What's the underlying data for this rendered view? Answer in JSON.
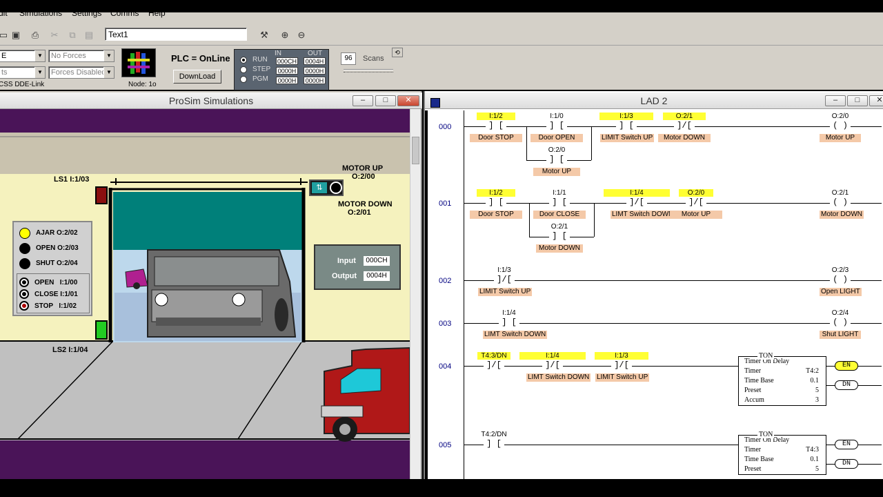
{
  "menu": [
    "dit",
    "Simulations",
    "Settings",
    "Comms",
    "Help"
  ],
  "toolbar": {
    "textbox_value": "Text1"
  },
  "settings": {
    "combo1": "E",
    "combo2": "ts",
    "forces": "No Forces",
    "forces_state": "Forces Disabled",
    "dde": "CSS DDE-Link",
    "node": "Node: 1o"
  },
  "plc": {
    "status": "PLC = OnLine",
    "download": "DownLoad",
    "modes": [
      "RUN",
      "STEP",
      "PGM"
    ],
    "in_header": "IN",
    "out_header": "OUT",
    "in_values": [
      "000CH",
      "0000H",
      "0000H"
    ],
    "out_values": [
      "0004H",
      "0000H",
      "0000H"
    ],
    "scans_value": "96",
    "scans_label": "Scans"
  },
  "prosim": {
    "title": "ProSim Simulations",
    "ls1": "LS1  I:1/03",
    "ls2": "LS2  I:1/04",
    "motor_up": "MOTOR UP",
    "motor_up_addr": "O:2/00",
    "motor_down": "MOTOR DOWN",
    "motor_down_addr": "O:2/01",
    "status_lights": [
      {
        "label": "AJAR",
        "addr": "O:2/02",
        "color": "#ffff00"
      },
      {
        "label": "OPEN",
        "addr": "O:2/03",
        "color": "#000000"
      },
      {
        "label": "SHUT",
        "addr": "O:2/04",
        "color": "#000000"
      }
    ],
    "buttons": [
      {
        "label": "OPEN",
        "addr": "I:1/00"
      },
      {
        "label": "CLOSE",
        "addr": "I:1/01"
      },
      {
        "label": "STOP",
        "addr": "I:1/02"
      }
    ],
    "io_input_label": "Input",
    "io_input_value": "000CH",
    "io_output_label": "Output",
    "io_output_value": "0004H"
  },
  "lad": {
    "title": "LAD 2",
    "rungs": [
      {
        "num": "000",
        "contacts": [
          {
            "addr": "I:1/2",
            "desc": "Door STOP",
            "sym": "] [",
            "hl": true
          },
          {
            "addr": "I:1/0",
            "desc": "Door OPEN",
            "sym": "] [",
            "hl": false
          },
          {
            "addr": "I:1/3",
            "desc": "LIMIT Switch UP",
            "sym": "] [",
            "hl": true
          },
          {
            "addr": "O:2/1",
            "desc": "Motor DOWN",
            "sym": "]/[",
            "hl": true
          }
        ],
        "branch": {
          "addr": "O:2/0",
          "desc": "Motor UP",
          "sym": "] ["
        },
        "coil": {
          "addr": "O:2/0",
          "desc": "Motor UP",
          "sym": "( )"
        }
      },
      {
        "num": "001",
        "contacts": [
          {
            "addr": "I:1/2",
            "desc": "Door STOP",
            "sym": "] [",
            "hl": true
          },
          {
            "addr": "I:1/1",
            "desc": "Door CLOSE",
            "sym": "] [",
            "hl": false
          },
          {
            "addr": "I:1/4",
            "desc": "LIMT Switch DOWN",
            "sym": "]/[",
            "hl": true
          },
          {
            "addr": "O:2/0",
            "desc": "Motor UP",
            "sym": "]/[",
            "hl": true
          }
        ],
        "branch": {
          "addr": "O:2/1",
          "desc": "Motor DOWN",
          "sym": "] ["
        },
        "coil": {
          "addr": "O:2/1",
          "desc": "Motor DOWN",
          "sym": "( )"
        }
      },
      {
        "num": "002",
        "contacts": [
          {
            "addr": "I:1/3",
            "desc": "LIMIT Switch UP",
            "sym": "]/[",
            "hl": false
          }
        ],
        "coil": {
          "addr": "O:2/3",
          "desc": "Open LIGHT",
          "sym": "( )"
        }
      },
      {
        "num": "003",
        "contacts": [
          {
            "addr": "I:1/4",
            "desc": "LIMT Switch DOWN",
            "sym": "] [",
            "hl": false
          }
        ],
        "coil": {
          "addr": "O:2/4",
          "desc": "Shut LIGHT",
          "sym": "( )"
        }
      },
      {
        "num": "004",
        "contacts": [
          {
            "addr": "T4:3/DN",
            "desc": "",
            "sym": "]/[",
            "hl": true
          },
          {
            "addr": "I:1/4",
            "desc": "LIMT Switch DOWN",
            "sym": "]/[",
            "hl": true
          },
          {
            "addr": "I:1/3",
            "desc": "LIMIT Switch UP",
            "sym": "]/[",
            "hl": true
          }
        ],
        "timer": {
          "header": "TON",
          "name": "Timer On Delay",
          "timer_label": "Timer",
          "timer": "T4:2",
          "base_label": "Time Base",
          "base": "0.1",
          "preset_label": "Preset",
          "preset": "5",
          "accum_label": "Accum",
          "accum": "3"
        },
        "en": "EN",
        "dn": "DN"
      },
      {
        "num": "005",
        "contacts": [
          {
            "addr": "T4:2/DN",
            "desc": "",
            "sym": "] [",
            "hl": false
          }
        ],
        "timer": {
          "header": "TON",
          "name": "Timer On Delay",
          "timer_label": "Timer",
          "timer": "T4:3",
          "base_label": "Time Base",
          "base": "0.1",
          "preset_label": "Preset",
          "preset": "5"
        },
        "en": "EN",
        "dn": "DN"
      }
    ]
  }
}
